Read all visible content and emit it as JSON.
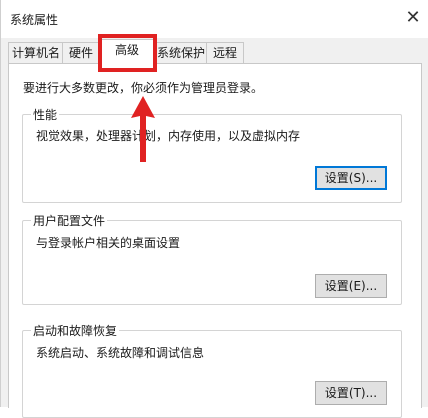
{
  "window": {
    "title": "系统属性",
    "close_glyph": "✕"
  },
  "tabs": [
    {
      "label": "计算机名"
    },
    {
      "label": "硬件"
    },
    {
      "label": "高级"
    },
    {
      "label": "系统保护"
    },
    {
      "label": "远程"
    }
  ],
  "admin_note": "要进行大多数更改，你必须作为管理员登录。",
  "groups": {
    "performance": {
      "label": "性能",
      "description": "视觉效果，处理器计划，内存使用，以及虚拟内存",
      "button": "设置(S)..."
    },
    "user_profiles": {
      "label": "用户配置文件",
      "description": "与登录帐户相关的桌面设置",
      "button": "设置(E)..."
    },
    "startup_recovery": {
      "label": "启动和故障恢复",
      "description": "系统启动、系统故障和调试信息",
      "button": "设置(T)..."
    }
  },
  "annotation_color": "#e02222"
}
